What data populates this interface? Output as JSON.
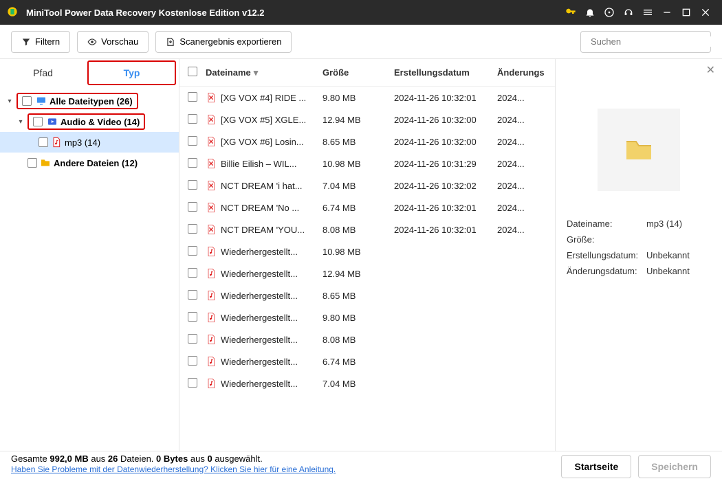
{
  "titlebar": {
    "title": "MiniTool Power Data Recovery Kostenlose Edition v12.2"
  },
  "toolbar": {
    "filter": "Filtern",
    "preview": "Vorschau",
    "export": "Scanergebnis exportieren",
    "search_placeholder": "Suchen"
  },
  "tabs": {
    "path": "Pfad",
    "type": "Typ"
  },
  "tree": {
    "all": "Alle Dateitypen (26)",
    "audio": "Audio & Video (14)",
    "mp3": "mp3 (14)",
    "other": "Andere Dateien (12)"
  },
  "grid": {
    "headers": {
      "name": "Dateiname",
      "size": "Größe",
      "created": "Erstellungsdatum",
      "modified": "Änderungs"
    },
    "rows": [
      {
        "name": "[XG VOX #4] RIDE ...",
        "size": "9.80 MB",
        "created": "2024-11-26 10:32:01",
        "mod": "2024...",
        "deleted": true
      },
      {
        "name": "[XG VOX #5] XGLE...",
        "size": "12.94 MB",
        "created": "2024-11-26 10:32:00",
        "mod": "2024...",
        "deleted": true
      },
      {
        "name": "[XG VOX #6] Losin...",
        "size": "8.65 MB",
        "created": "2024-11-26 10:32:00",
        "mod": "2024...",
        "deleted": true
      },
      {
        "name": "Billie Eilish – WIL...",
        "size": "10.98 MB",
        "created": "2024-11-26 10:31:29",
        "mod": "2024...",
        "deleted": true
      },
      {
        "name": "NCT DREAM 'i hat...",
        "size": "7.04 MB",
        "created": "2024-11-26 10:32:02",
        "mod": "2024...",
        "deleted": true
      },
      {
        "name": "NCT DREAM 'No ...",
        "size": "6.74 MB",
        "created": "2024-11-26 10:32:01",
        "mod": "2024...",
        "deleted": true
      },
      {
        "name": "NCT DREAM 'YOU...",
        "size": "8.08 MB",
        "created": "2024-11-26 10:32:01",
        "mod": "2024...",
        "deleted": true
      },
      {
        "name": "Wiederhergestellt...",
        "size": "10.98 MB",
        "created": "",
        "mod": "",
        "deleted": false
      },
      {
        "name": "Wiederhergestellt...",
        "size": "12.94 MB",
        "created": "",
        "mod": "",
        "deleted": false
      },
      {
        "name": "Wiederhergestellt...",
        "size": "8.65 MB",
        "created": "",
        "mod": "",
        "deleted": false
      },
      {
        "name": "Wiederhergestellt...",
        "size": "9.80 MB",
        "created": "",
        "mod": "",
        "deleted": false
      },
      {
        "name": "Wiederhergestellt...",
        "size": "8.08 MB",
        "created": "",
        "mod": "",
        "deleted": false
      },
      {
        "name": "Wiederhergestellt...",
        "size": "6.74 MB",
        "created": "",
        "mod": "",
        "deleted": false
      },
      {
        "name": "Wiederhergestellt...",
        "size": "7.04 MB",
        "created": "",
        "mod": "",
        "deleted": false
      }
    ]
  },
  "details": {
    "name_label": "Dateiname:",
    "name_value": "mp3 (14)",
    "size_label": "Größe:",
    "size_value": "",
    "created_label": "Erstellungsdatum:",
    "created_value": "Unbekannt",
    "modified_label": "Änderungsdatum:",
    "modified_value": "Unbekannt"
  },
  "footer": {
    "stats_html_parts": [
      "Gesamte ",
      "992,0 MB",
      " aus ",
      "26",
      " Dateien.  ",
      "0 Bytes",
      " aus ",
      "0",
      " ausgewählt."
    ],
    "help_link": "Haben Sie Probleme mit der Datenwiederherstellung? Klicken Sie hier für eine Anleitung.",
    "home": "Startseite",
    "save": "Speichern"
  }
}
